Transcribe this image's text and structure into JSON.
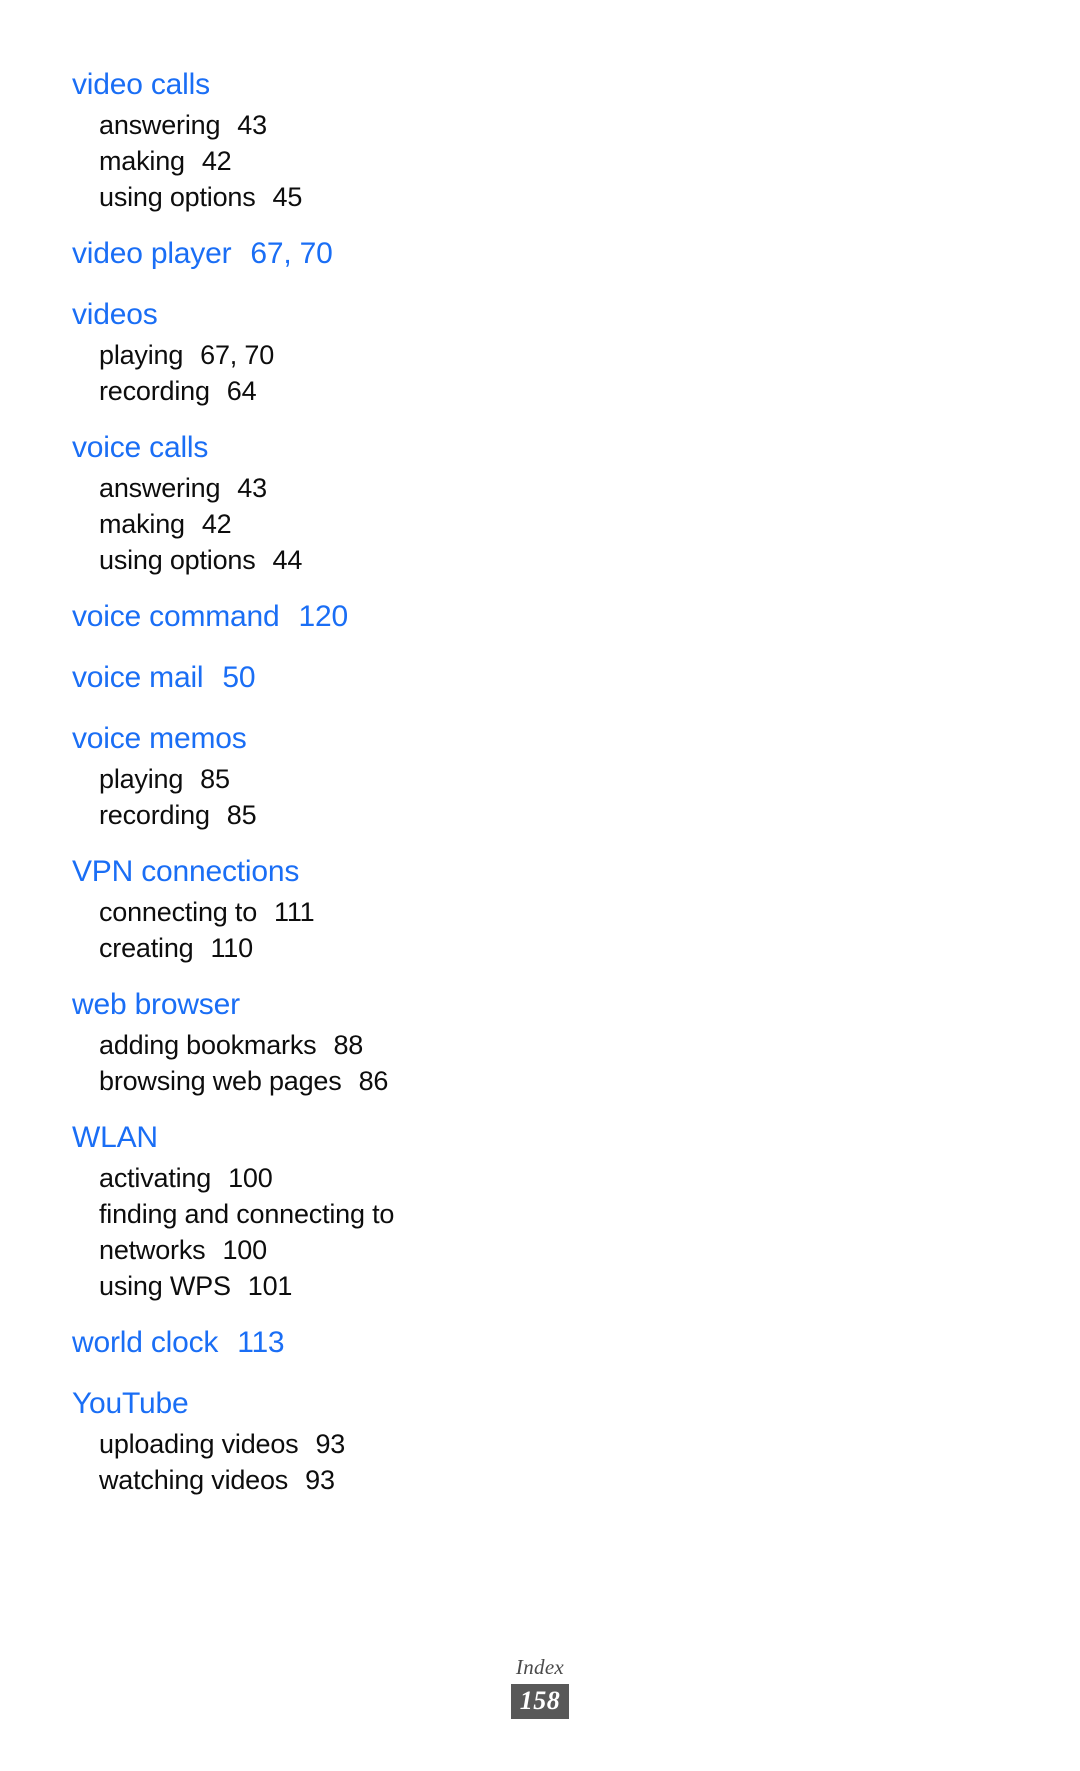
{
  "document": {
    "type": "book-index-page",
    "accent_color": "#1a6ef5",
    "body_color": "#0d0d0d",
    "footer_box_color": "#595959"
  },
  "index": {
    "groups": [
      {
        "heading": "video calls",
        "heading_pages": "",
        "entries": [
          {
            "label": "answering",
            "pages": "43"
          },
          {
            "label": "making",
            "pages": "42"
          },
          {
            "label": "using options",
            "pages": "45"
          }
        ]
      },
      {
        "heading": "video player",
        "heading_pages": "67, 70",
        "entries": []
      },
      {
        "heading": "videos",
        "heading_pages": "",
        "entries": [
          {
            "label": "playing",
            "pages": "67, 70"
          },
          {
            "label": "recording",
            "pages": "64"
          }
        ]
      },
      {
        "heading": "voice calls",
        "heading_pages": "",
        "entries": [
          {
            "label": "answering",
            "pages": "43"
          },
          {
            "label": "making",
            "pages": "42"
          },
          {
            "label": "using options",
            "pages": "44"
          }
        ]
      },
      {
        "heading": "voice command",
        "heading_pages": "120",
        "entries": []
      },
      {
        "heading": "voice mail",
        "heading_pages": "50",
        "entries": []
      },
      {
        "heading": "voice memos",
        "heading_pages": "",
        "entries": [
          {
            "label": "playing",
            "pages": "85"
          },
          {
            "label": "recording",
            "pages": "85"
          }
        ]
      },
      {
        "heading": "VPN connections",
        "heading_pages": "",
        "entries": [
          {
            "label": "connecting to",
            "pages": "111"
          },
          {
            "label": "creating",
            "pages": "110"
          }
        ]
      },
      {
        "heading": "web browser",
        "heading_pages": "",
        "entries": [
          {
            "label": "adding bookmarks",
            "pages": "88"
          },
          {
            "label": "browsing web pages",
            "pages": "86"
          }
        ]
      },
      {
        "heading": "WLAN",
        "heading_pages": "",
        "entries": [
          {
            "label": "activating",
            "pages": "100"
          },
          {
            "label": "finding and connecting to networks",
            "pages": "100",
            "wraps": true
          },
          {
            "label": "using WPS",
            "pages": "101"
          }
        ]
      },
      {
        "heading": "world clock",
        "heading_pages": "113",
        "entries": []
      },
      {
        "heading": "YouTube",
        "heading_pages": "",
        "entries": [
          {
            "label": "uploading videos",
            "pages": "93"
          },
          {
            "label": "watching videos",
            "pages": "93"
          }
        ]
      }
    ]
  },
  "footer": {
    "section_label": "Index",
    "page_number": "158"
  }
}
